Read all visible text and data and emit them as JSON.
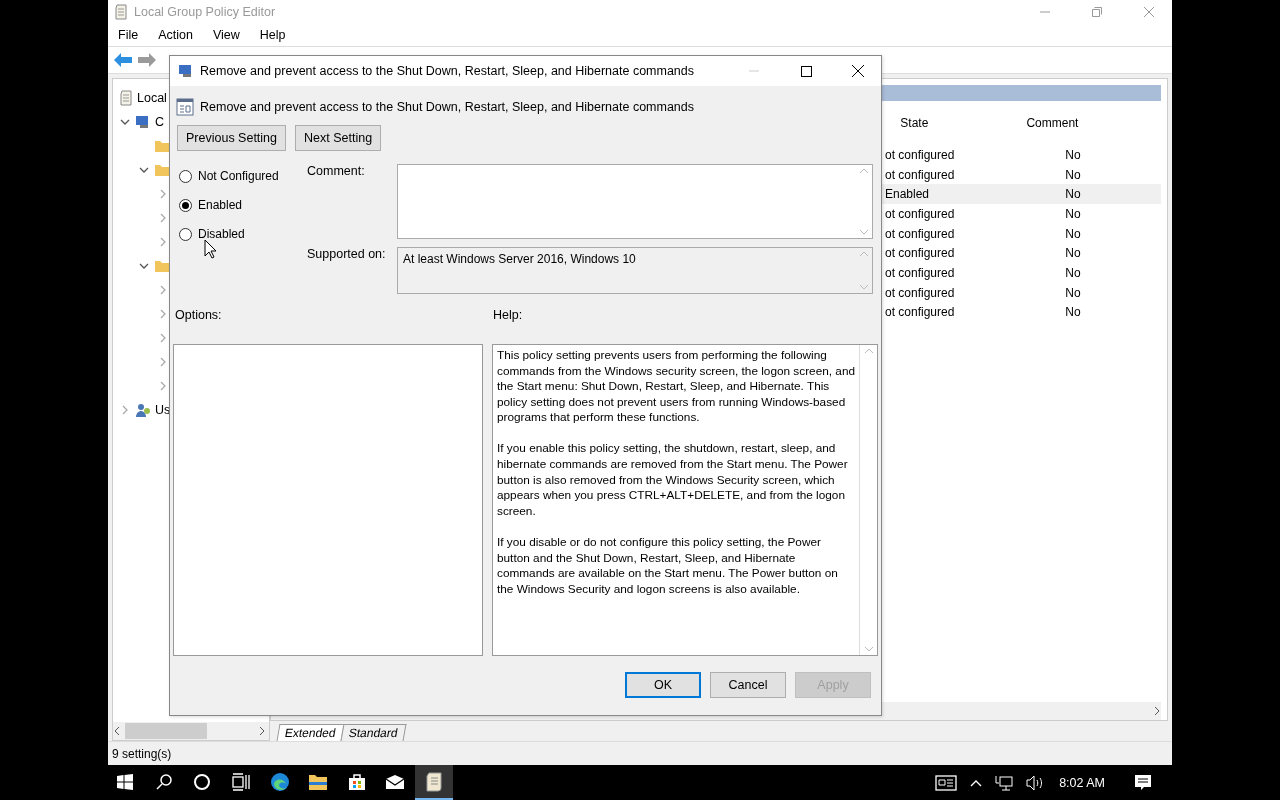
{
  "main_window": {
    "title": "Local Group Policy Editor",
    "menu": [
      "File",
      "Action",
      "View",
      "Help"
    ],
    "tree": [
      {
        "label": "Local",
        "kind": "policy",
        "children": [
          {
            "label": "C",
            "kind": "computer",
            "expanded": true,
            "children": [
              {
                "kind": "folder"
              },
              {
                "kind": "folder",
                "expanded": true,
                "children": [
                  {
                    "expanded": false
                  },
                  {
                    "expanded": false
                  },
                  {
                    "expanded": false
                  }
                ]
              },
              {
                "kind": "folder",
                "expanded": true,
                "children": [
                  {
                    "expanded": false
                  },
                  {
                    "expanded": false
                  },
                  {
                    "expanded": false
                  },
                  {
                    "expanded": false
                  },
                  {
                    "expanded": false
                  }
                ]
              }
            ]
          },
          {
            "label": "Us",
            "kind": "users",
            "expanded": false
          }
        ]
      }
    ],
    "list": {
      "columns": [
        "State",
        "Comment"
      ],
      "rows": [
        {
          "state": "ot configured",
          "comment": "No",
          "selected": false
        },
        {
          "state": "ot configured",
          "comment": "No",
          "selected": false
        },
        {
          "state": "Enabled",
          "comment": "No",
          "selected": true
        },
        {
          "state": "ot configured",
          "comment": "No",
          "selected": false
        },
        {
          "state": "ot configured",
          "comment": "No",
          "selected": false
        },
        {
          "state": "ot configured",
          "comment": "No",
          "selected": false
        },
        {
          "state": "ot configured",
          "comment": "No",
          "selected": false
        },
        {
          "state": "ot configured",
          "comment": "No",
          "selected": false
        },
        {
          "state": "ot configured",
          "comment": "No",
          "selected": false
        }
      ]
    },
    "tabs": [
      {
        "label": "Extended",
        "selected": true
      },
      {
        "label": "Standard",
        "selected": false
      }
    ],
    "status_bar": "9 setting(s)"
  },
  "dialog": {
    "title": "Remove and prevent access to the Shut Down, Restart, Sleep, and Hibernate commands",
    "heading": "Remove and prevent access to the Shut Down, Restart, Sleep, and Hibernate commands",
    "nav_buttons": [
      "Previous Setting",
      "Next Setting"
    ],
    "radios": [
      {
        "label": "Not Configured",
        "selected": false
      },
      {
        "label": "Enabled",
        "selected": true
      },
      {
        "label": "Disabled",
        "selected": false
      }
    ],
    "comment_label": "Comment:",
    "supported_label": "Supported on:",
    "supported_value": "At least Windows Server 2016, Windows 10",
    "options_label": "Options:",
    "help_label": "Help:",
    "help": [
      "This policy setting prevents users from performing the following commands from the Windows security screen, the logon screen, and the Start menu: Shut Down, Restart, Sleep, and Hibernate. This policy setting does not prevent users from running Windows-based programs that perform these functions.",
      "If you enable this policy setting, the shutdown, restart, sleep, and hibernate commands are removed from the Start menu. The Power button is also removed from the Windows Security screen, which appears when you press CTRL+ALT+DELETE, and from the logon screen.",
      "If you disable or do not configure this policy setting, the Power button and the Shut Down, Restart, Sleep, and Hibernate commands are available on the Start menu. The Power button on the Windows Security and logon screens is also available."
    ],
    "buttons": [
      {
        "label": "OK",
        "kind": "default",
        "disabled": false
      },
      {
        "label": "Cancel",
        "kind": "normal",
        "disabled": false
      },
      {
        "label": "Apply",
        "kind": "normal",
        "disabled": true
      }
    ]
  },
  "taskbar": {
    "apps": [
      {
        "kind": "start",
        "active": false
      },
      {
        "kind": "search",
        "active": false
      },
      {
        "kind": "cortana",
        "active": false
      },
      {
        "kind": "taskview",
        "active": false
      },
      {
        "kind": "edge",
        "active": false
      },
      {
        "kind": "explorer",
        "active": false
      },
      {
        "kind": "store",
        "active": false
      },
      {
        "kind": "mail",
        "active": false
      },
      {
        "kind": "policy",
        "active": true
      }
    ],
    "time": "8:02 AM"
  }
}
